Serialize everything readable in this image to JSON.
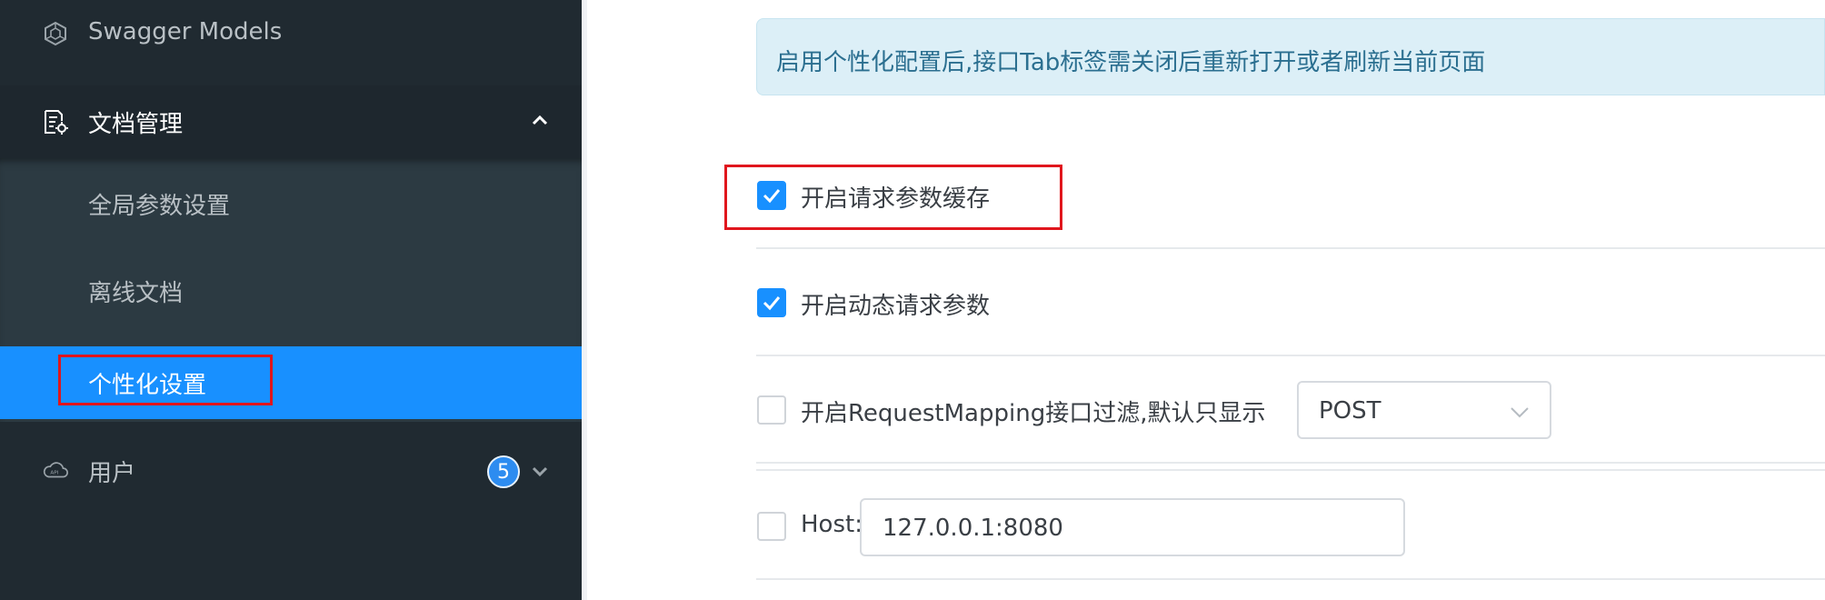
{
  "sidebar": {
    "items": [
      {
        "label": "Swagger Models",
        "icon": "hexagon-cube-icon"
      },
      {
        "label": "文档管理",
        "icon": "document-gear-icon",
        "expanded": true,
        "children": [
          {
            "label": "全局参数设置"
          },
          {
            "label": "离线文档"
          },
          {
            "label": "个性化设置",
            "active": true
          }
        ]
      },
      {
        "label": "用户",
        "icon": "cloud-api-icon",
        "badge": "5"
      }
    ]
  },
  "main": {
    "alert": "启用个性化配置后,接口Tab标签需关闭后重新打开或者刷新当前页面",
    "options": [
      {
        "label": "开启请求参数缓存",
        "checked": true
      },
      {
        "label": "开启动态请求参数",
        "checked": true
      },
      {
        "label": "开启RequestMapping接口过滤,默认只显示",
        "checked": false
      },
      {
        "label": "Host:",
        "checked": false
      }
    ],
    "method_select": {
      "value": "POST"
    },
    "host_input": {
      "value": "127.0.0.1:8080"
    }
  },
  "colors": {
    "sidebar_bg": "#202a31",
    "active_bg": "#1890ff",
    "highlight_border": "#e0161d",
    "alert_bg": "#dceff7"
  }
}
